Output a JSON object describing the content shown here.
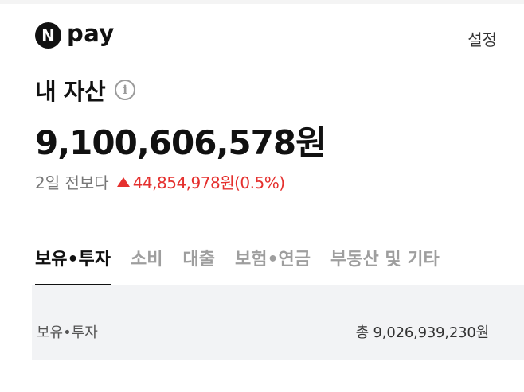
{
  "header": {
    "logo_mark": "N",
    "logo_text": "pay",
    "settings_label": "설정"
  },
  "assets": {
    "title": "내 자산",
    "info_icon": "info-icon",
    "total": "9,100,606,578원",
    "change_label": "2일 전보다",
    "change_direction_icon": "triangle-up-icon",
    "change_value": "44,854,978원(0.5%)"
  },
  "tabs": [
    {
      "label": "보유•투자",
      "active": true
    },
    {
      "label": "소비",
      "active": false
    },
    {
      "label": "대출",
      "active": false
    },
    {
      "label": "보험•연금",
      "active": false
    },
    {
      "label": "부동산 및 기타",
      "active": false
    }
  ],
  "section": {
    "label": "보유•투자",
    "total": "총 9,026,939,230원"
  },
  "colors": {
    "accent_up": "#e5302e",
    "section_bg": "#f2f3f5"
  }
}
